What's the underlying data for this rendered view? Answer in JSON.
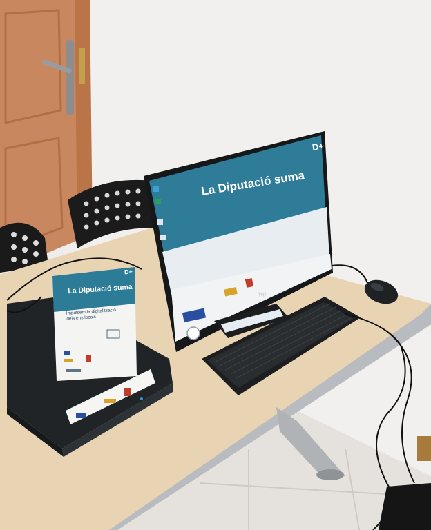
{
  "monitor": {
    "screen_title": "La Diputació suma",
    "logo": "D+"
  },
  "sign": {
    "title": "La Diputació suma",
    "logo": "D+",
    "subtitle": "Impulsem la digitalització dels ens locals"
  },
  "colors": {
    "wall": "#eeedeb",
    "desk": "#e7d2b2",
    "door": "#c8865e",
    "teal": "#2f7c99",
    "screen_lower": "#e9eef3",
    "laptop": "#1f2326",
    "keyboard": "#1c1e20",
    "floor": "#e6e3df"
  }
}
